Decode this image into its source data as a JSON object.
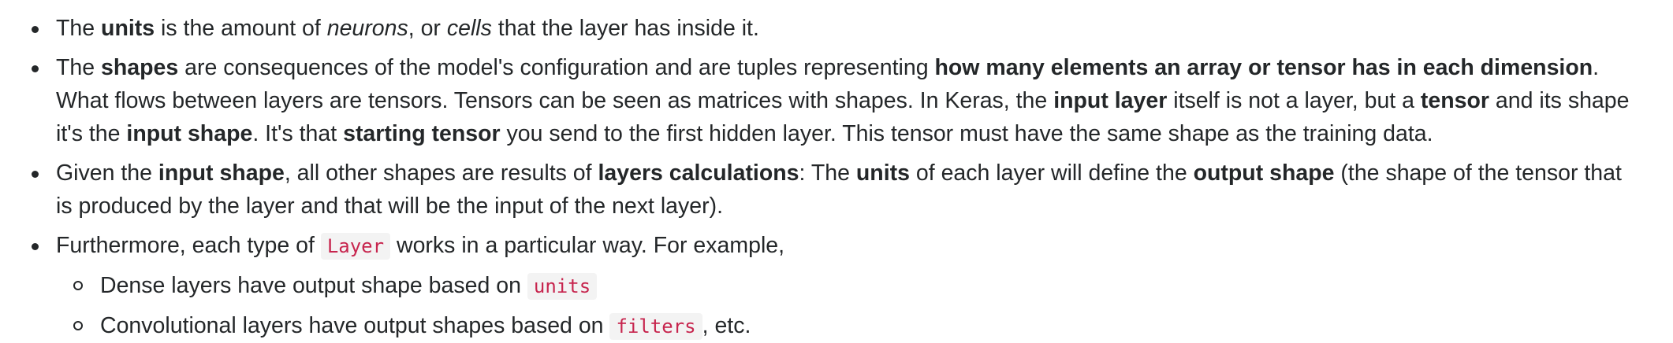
{
  "items": [
    {
      "t1": "The ",
      "b1": "units",
      "t2": " is the amount of ",
      "i1": "neurons",
      "t3": ", or ",
      "i2": "cells",
      "t4": " that the layer has inside it."
    },
    {
      "t1": "The ",
      "b1": "shapes",
      "t2": " are consequences of the model's configuration and are tuples representing ",
      "b2": "how many elements an array or tensor has in each dimension",
      "t3": ". What flows between layers are tensors. Tensors can be seen as matrices with shapes. In Keras, the ",
      "b3": "input layer",
      "t4": " itself is not a layer, but a ",
      "b4": "tensor",
      "t5": " and its shape it's the ",
      "b5": "input shape",
      "t6": ". It's that ",
      "b6": "starting tensor",
      "t7": " you send to the first hidden layer. This tensor must have the same shape as the training data."
    },
    {
      "t1": "Given the ",
      "b1": "input shape",
      "t2": ", all other shapes are results of ",
      "b2": "layers calculations",
      "t3": ": The ",
      "b3": "units",
      "t4": " of each layer will define the ",
      "b4": "output shape",
      "t5": " (the shape of the tensor that is produced by the layer and that will be the input of the next layer)."
    },
    {
      "t1": "Furthermore, each type of ",
      "c1": "Layer",
      "t2": " works in a particular way. For example,",
      "sub": [
        {
          "t1": "Dense layers have output shape based on ",
          "c1": "units",
          "t2": ""
        },
        {
          "t1": "Convolutional layers have output shapes based on ",
          "c1": "filters",
          "t2": ", etc."
        }
      ]
    }
  ]
}
